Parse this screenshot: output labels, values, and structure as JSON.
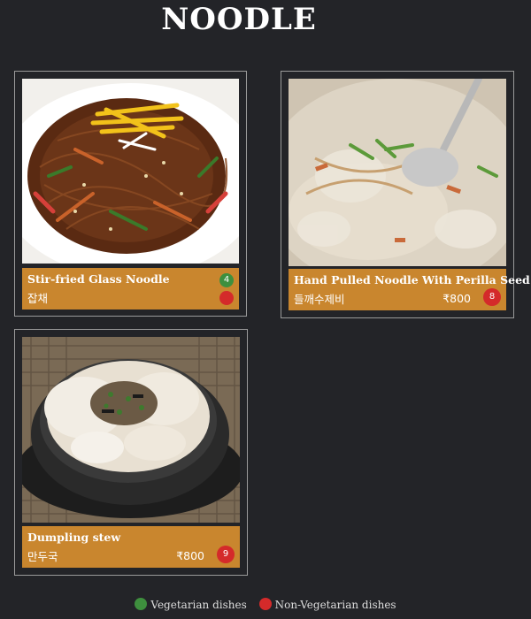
{
  "page": {
    "title": "NOODLE"
  },
  "items": [
    {
      "name": "Stir-fried Glass Noodle",
      "korean": "잡채",
      "price": "",
      "veg_number": "4",
      "nonveg_number": ""
    },
    {
      "name": "Hand Pulled Noodle With Perilla Seed",
      "korean": "들깨수제비",
      "price": "₹800",
      "veg_number": "",
      "nonveg_number": "8"
    },
    {
      "name": "Dumpling stew",
      "korean": "만두국",
      "price": "₹800",
      "veg_number": "",
      "nonveg_number": "9"
    }
  ],
  "legend": {
    "veg_label": "Vegetarian dishes",
    "nonveg_label": "Non-Vegetarian dishes"
  },
  "colors": {
    "background": "#232428",
    "label_bg": "#c9862e",
    "veg": "#3e8f3e",
    "nonveg": "#d42a2a",
    "border": "#9a9a9a"
  },
  "icons": {
    "veg_marker": "green-dot-icon",
    "nonveg_marker": "red-dot-icon"
  }
}
